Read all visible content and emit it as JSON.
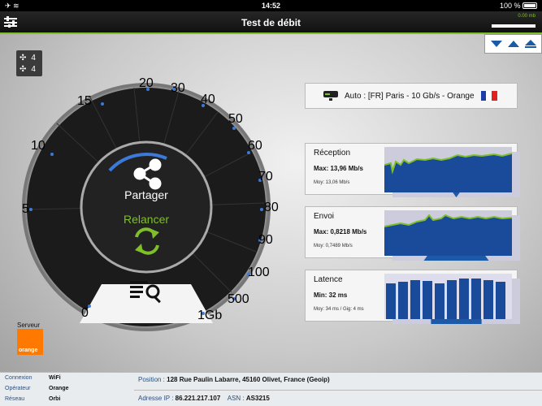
{
  "status_bar": {
    "time": "14:52",
    "battery": "100 %"
  },
  "title": "Test de débit",
  "signal_label": "0.00 mb",
  "counters": {
    "top": "4",
    "bottom": "4"
  },
  "gauge": {
    "ticks": [
      "0",
      "5",
      "10",
      "15",
      "20",
      "30",
      "40",
      "50",
      "60",
      "70",
      "80",
      "90",
      "100",
      "500",
      "1Gb"
    ],
    "share_label": "Partager",
    "restart_label": "Relancer"
  },
  "server": {
    "label": "Serveur",
    "logo_text": "orange",
    "name": "Auto : [FR] Paris - 10 Gb/s - Orange"
  },
  "colors": {
    "accent": "#7fbf2a",
    "chart_blue": "#1a4a9a",
    "brand_orange": "#ff7900"
  },
  "panels": {
    "reception": {
      "title": "Réception",
      "max": "Max: 13,96 Mb/s",
      "moy": "Moy: 13,06 Mb/s"
    },
    "envoi": {
      "title": "Envoi",
      "max": "Max: 0,8218 Mb/s",
      "moy": "Moy: 0,7489 Mb/s"
    },
    "latence": {
      "title": "Latence",
      "min": "Min: 32 ms",
      "moy": "Moy: 34 ms / Gig: 4 ms"
    }
  },
  "info": {
    "connexion_label": "Connexion",
    "connexion": "WiFi",
    "operateur_label": "Opérateur",
    "operateur": "Orange",
    "reseau_label": "Réseau",
    "reseau": "Orbi",
    "position_label": "Position :",
    "position": "128 Rue Paulin Labarre, 45160 Olivet, France (Geoip)",
    "ip_label": "Adresse IP :",
    "ip": "86.221.217.107",
    "asn_label": "ASN :",
    "asn": "AS3215"
  }
}
